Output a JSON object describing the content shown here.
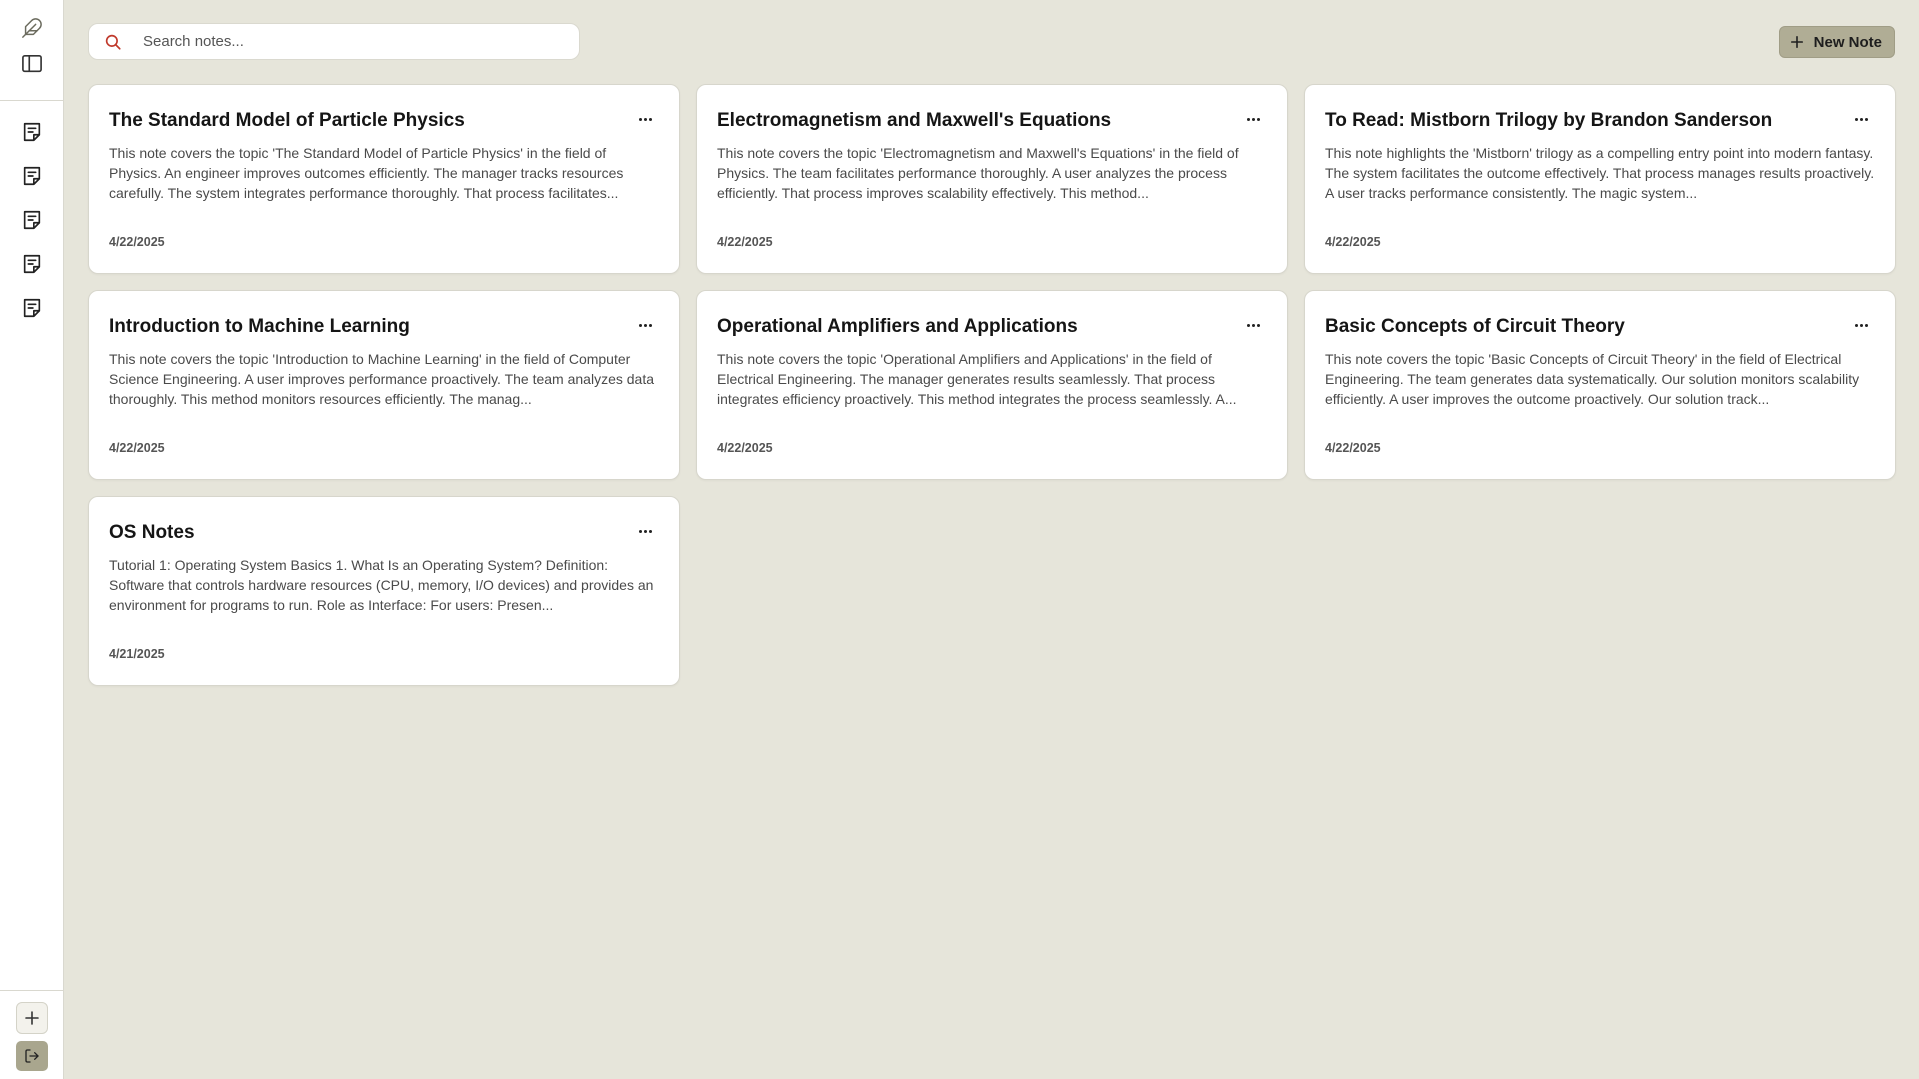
{
  "sidebar": {
    "note_icons": [
      "note-icon",
      "note-icon",
      "note-icon",
      "note-icon",
      "note-icon"
    ]
  },
  "search": {
    "placeholder": "Search notes..."
  },
  "toolbar": {
    "new_note_label": "New Note"
  },
  "colors": {
    "background": "#e6e5da",
    "accent": "#b0ad95",
    "search_icon": "#c0392b"
  },
  "notes": [
    {
      "title": "The Standard Model of Particle Physics",
      "body": "This note covers the topic 'The Standard Model of Particle Physics' in the field of Physics. An engineer improves outcomes efficiently. The manager tracks resources carefully. The system integrates performance thoroughly. That process facilitates...",
      "date": "4/22/2025"
    },
    {
      "title": "Electromagnetism and Maxwell's Equations",
      "body": "This note covers the topic 'Electromagnetism and Maxwell's Equations' in the field of Physics. The team facilitates performance thoroughly. A user analyzes the process efficiently. That process improves scalability effectively. This method...",
      "date": "4/22/2025"
    },
    {
      "title": "To Read: Mistborn Trilogy by Brandon Sanderson",
      "body": "This note highlights the 'Mistborn' trilogy as a compelling entry point into modern fantasy. The system facilitates the outcome effectively. That process manages results proactively. A user tracks performance consistently. The magic system...",
      "date": "4/22/2025"
    },
    {
      "title": "Introduction to Machine Learning",
      "body": "This note covers the topic 'Introduction to Machine Learning' in the field of Computer Science Engineering. A user improves performance proactively. The team analyzes data thoroughly. This method monitors resources efficiently. The manag...",
      "date": "4/22/2025"
    },
    {
      "title": "Operational Amplifiers and Applications",
      "body": "This note covers the topic 'Operational Amplifiers and Applications' in the field of Electrical Engineering. The manager generates results seamlessly. That process integrates efficiency proactively. This method integrates the process seamlessly. A...",
      "date": "4/22/2025"
    },
    {
      "title": "Basic Concepts of Circuit Theory",
      "body": "This note covers the topic 'Basic Concepts of Circuit Theory' in the field of Electrical Engineering. The team generates data systematically. Our solution monitors scalability efficiently. A user improves the outcome proactively. Our solution track...",
      "date": "4/22/2025"
    },
    {
      "title": "OS Notes",
      "body": "Tutorial 1: Operating System Basics 1. What Is an Operating System? Definition: Software that controls hardware resources (CPU, memory, I/O devices) and provides an environment for programs to run. Role as Interface: For users: Presen...",
      "date": "4/21/2025"
    }
  ]
}
